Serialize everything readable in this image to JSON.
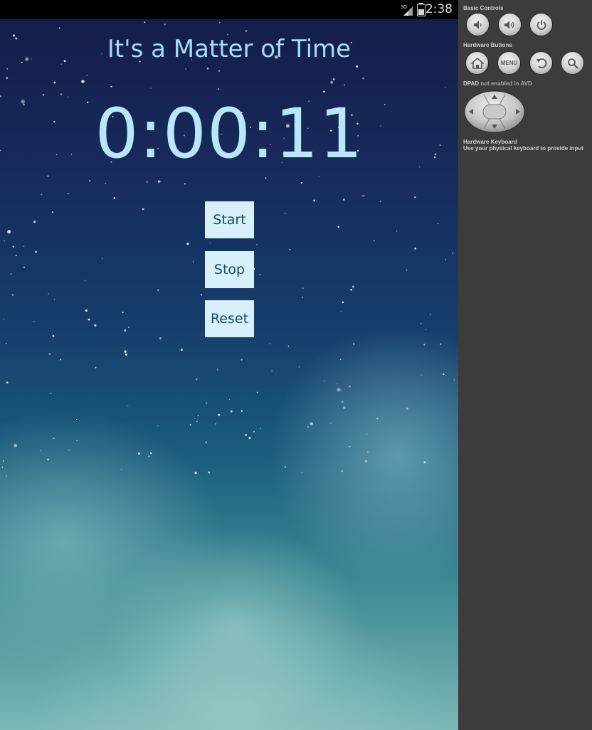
{
  "status_bar": {
    "time": "2:38",
    "network_type": "3G"
  },
  "app": {
    "title": "It's a Matter of Time",
    "timer": "0:00:11",
    "buttons": {
      "start": "Start",
      "stop": "Stop",
      "reset": "Reset"
    }
  },
  "emulator_panel": {
    "basic_controls_label": "Basic Controls",
    "basic_controls_icons": [
      "volume-down-icon",
      "volume-up-icon",
      "power-icon"
    ],
    "hardware_buttons_label": "Hardware Buttons",
    "hardware_buttons_icons": [
      "home-icon",
      "menu-button",
      "back-icon",
      "search-icon"
    ],
    "menu_label": "MENU",
    "dpad_prefix": "DPAD",
    "dpad_note": " not enabled in AVD",
    "keyboard_label": "Hardware Keyboard",
    "keyboard_note": "Use your physical keyboard to provide input"
  },
  "colors": {
    "title_text": "#a6dcf6",
    "timer_text": "#b9e6fb",
    "button_bg": "#d7f0fa",
    "button_text": "#1b4a64",
    "panel_bg": "#3c3c3c",
    "status_bar_bg": "#000000"
  }
}
